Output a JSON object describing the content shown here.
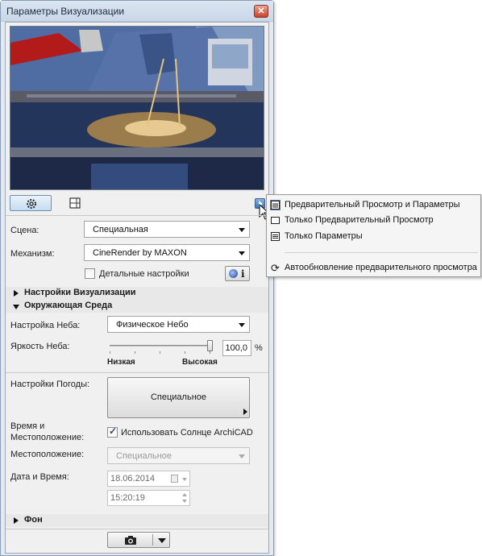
{
  "window": {
    "title": "Параметры Визуализации",
    "close_label": "✕"
  },
  "form": {
    "scene_label": "Сцена:",
    "scene_value": "Специальная",
    "engine_label": "Механизм:",
    "engine_value": "CineRender by MAXON",
    "detailed_label": "Детальные настройки",
    "info_label": "i"
  },
  "sections": {
    "render_settings": "Настройки Визуализации",
    "environment": "Окружающая Среда",
    "background": "Фон"
  },
  "environment": {
    "sky_settings_label": "Настройка Неба:",
    "sky_settings_value": "Физическое Небо",
    "sky_brightness_label": "Яркость Неба:",
    "sky_brightness_value": "100,0",
    "sky_brightness_unit": "%",
    "slider_low": "Низкая",
    "slider_high": "Высокая",
    "sky_brightness_level": 1.0,
    "weather_label": "Настройки Погоды:",
    "weather_value": "Специальное",
    "time_location_label_1": "Время и",
    "time_location_label_2": "Местоположение:",
    "use_sun_label": "Использовать Солнце ArchiCAD",
    "use_sun_checked": true,
    "location_label": "Местоположение:",
    "location_value": "Специальное",
    "date_time_label": "Дата и Время:",
    "date_value": "18.06.2014",
    "time_value": "15:20:19"
  },
  "popup_menu": {
    "items": [
      {
        "label": "Предварительный Просмотр и Параметры",
        "icon": "preview-and-params-icon",
        "selected": true
      },
      {
        "label": "Только Предварительный Просмотр",
        "icon": "preview-only-icon",
        "selected": false
      },
      {
        "label": "Только Параметры",
        "icon": "params-only-icon",
        "selected": false
      },
      {
        "label": "Автообновление предварительного просмотра",
        "icon": "auto-refresh-icon",
        "selected": false
      }
    ]
  },
  "colors": {
    "accent": "#2a5fb0",
    "panel": "#f0f0f0",
    "frame": "#e3e9f1"
  }
}
